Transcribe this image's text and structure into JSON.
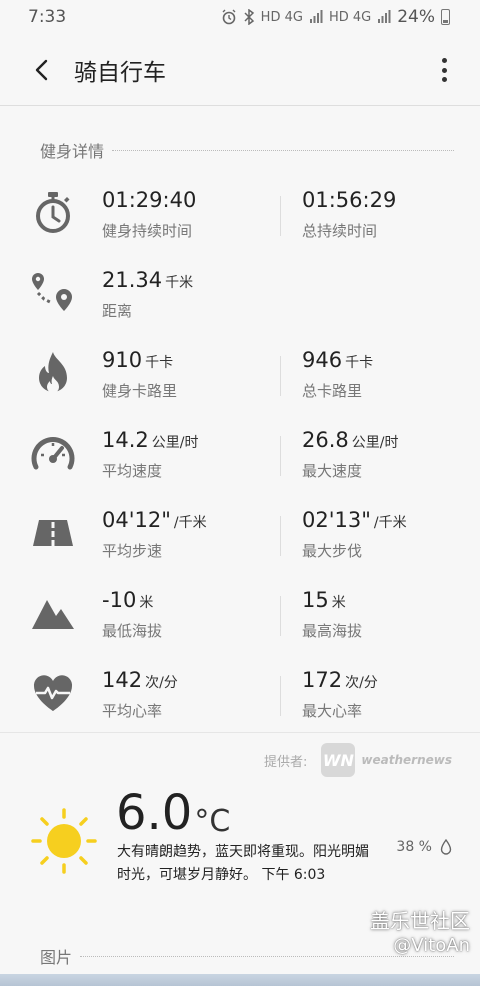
{
  "status": {
    "time": "7:33",
    "network": "HD 4G",
    "network2": "HD 4G",
    "battery": "24%"
  },
  "app_bar": {
    "title": "骑自行车"
  },
  "fitness": {
    "section_title": "健身详情",
    "rows": [
      {
        "icon": "stopwatch-icon",
        "c1": {
          "value": "01:29:40",
          "unit": "",
          "label": "健身持续时间"
        },
        "c2": {
          "value": "01:56:29",
          "unit": "",
          "label": "总持续时间"
        }
      },
      {
        "icon": "route-icon",
        "c1": {
          "value": "21.34",
          "unit": "千米",
          "label": "距离"
        }
      },
      {
        "icon": "flame-icon",
        "c1": {
          "value": "910",
          "unit": "千卡",
          "label": "健身卡路里"
        },
        "c2": {
          "value": "946",
          "unit": "千卡",
          "label": "总卡路里"
        }
      },
      {
        "icon": "speedometer-icon",
        "c1": {
          "value": "14.2",
          "unit": "公里/时",
          "label": "平均速度"
        },
        "c2": {
          "value": "26.8",
          "unit": "公里/时",
          "label": "最大速度"
        }
      },
      {
        "icon": "road-icon",
        "c1": {
          "value": "04'12\"",
          "unit": "/千米",
          "label": "平均步速"
        },
        "c2": {
          "value": "02'13\"",
          "unit": "/千米",
          "label": "最大步伐"
        }
      },
      {
        "icon": "mountain-icon",
        "c1": {
          "value": "-10",
          "unit": "米",
          "label": "最低海拔"
        },
        "c2": {
          "value": "15",
          "unit": "米",
          "label": "最高海拔"
        }
      },
      {
        "icon": "heart-rate-icon",
        "c1": {
          "value": "142",
          "unit": "次/分",
          "label": "平均心率"
        },
        "c2": {
          "value": "172",
          "unit": "次/分",
          "label": "最大心率"
        }
      }
    ]
  },
  "weather": {
    "provider_label": "提供者:",
    "provider_logo": "WN",
    "provider_name": "weathernews",
    "temperature": "6.0",
    "temp_unit": "°C",
    "description": "大有晴朗趋势，蓝天即将重现。阳光明媚时光，可堪岁月静好。 下午 6:03",
    "humidity": "38 %",
    "icon": "sun-icon"
  },
  "images": {
    "section_title": "图片"
  },
  "watermark": {
    "line1": "盖乐世社区",
    "line2": "@VitoAn"
  },
  "colors": {
    "background": "#f7f7f7",
    "sun": "#f6cf1f",
    "icon_gray": "#666666"
  }
}
